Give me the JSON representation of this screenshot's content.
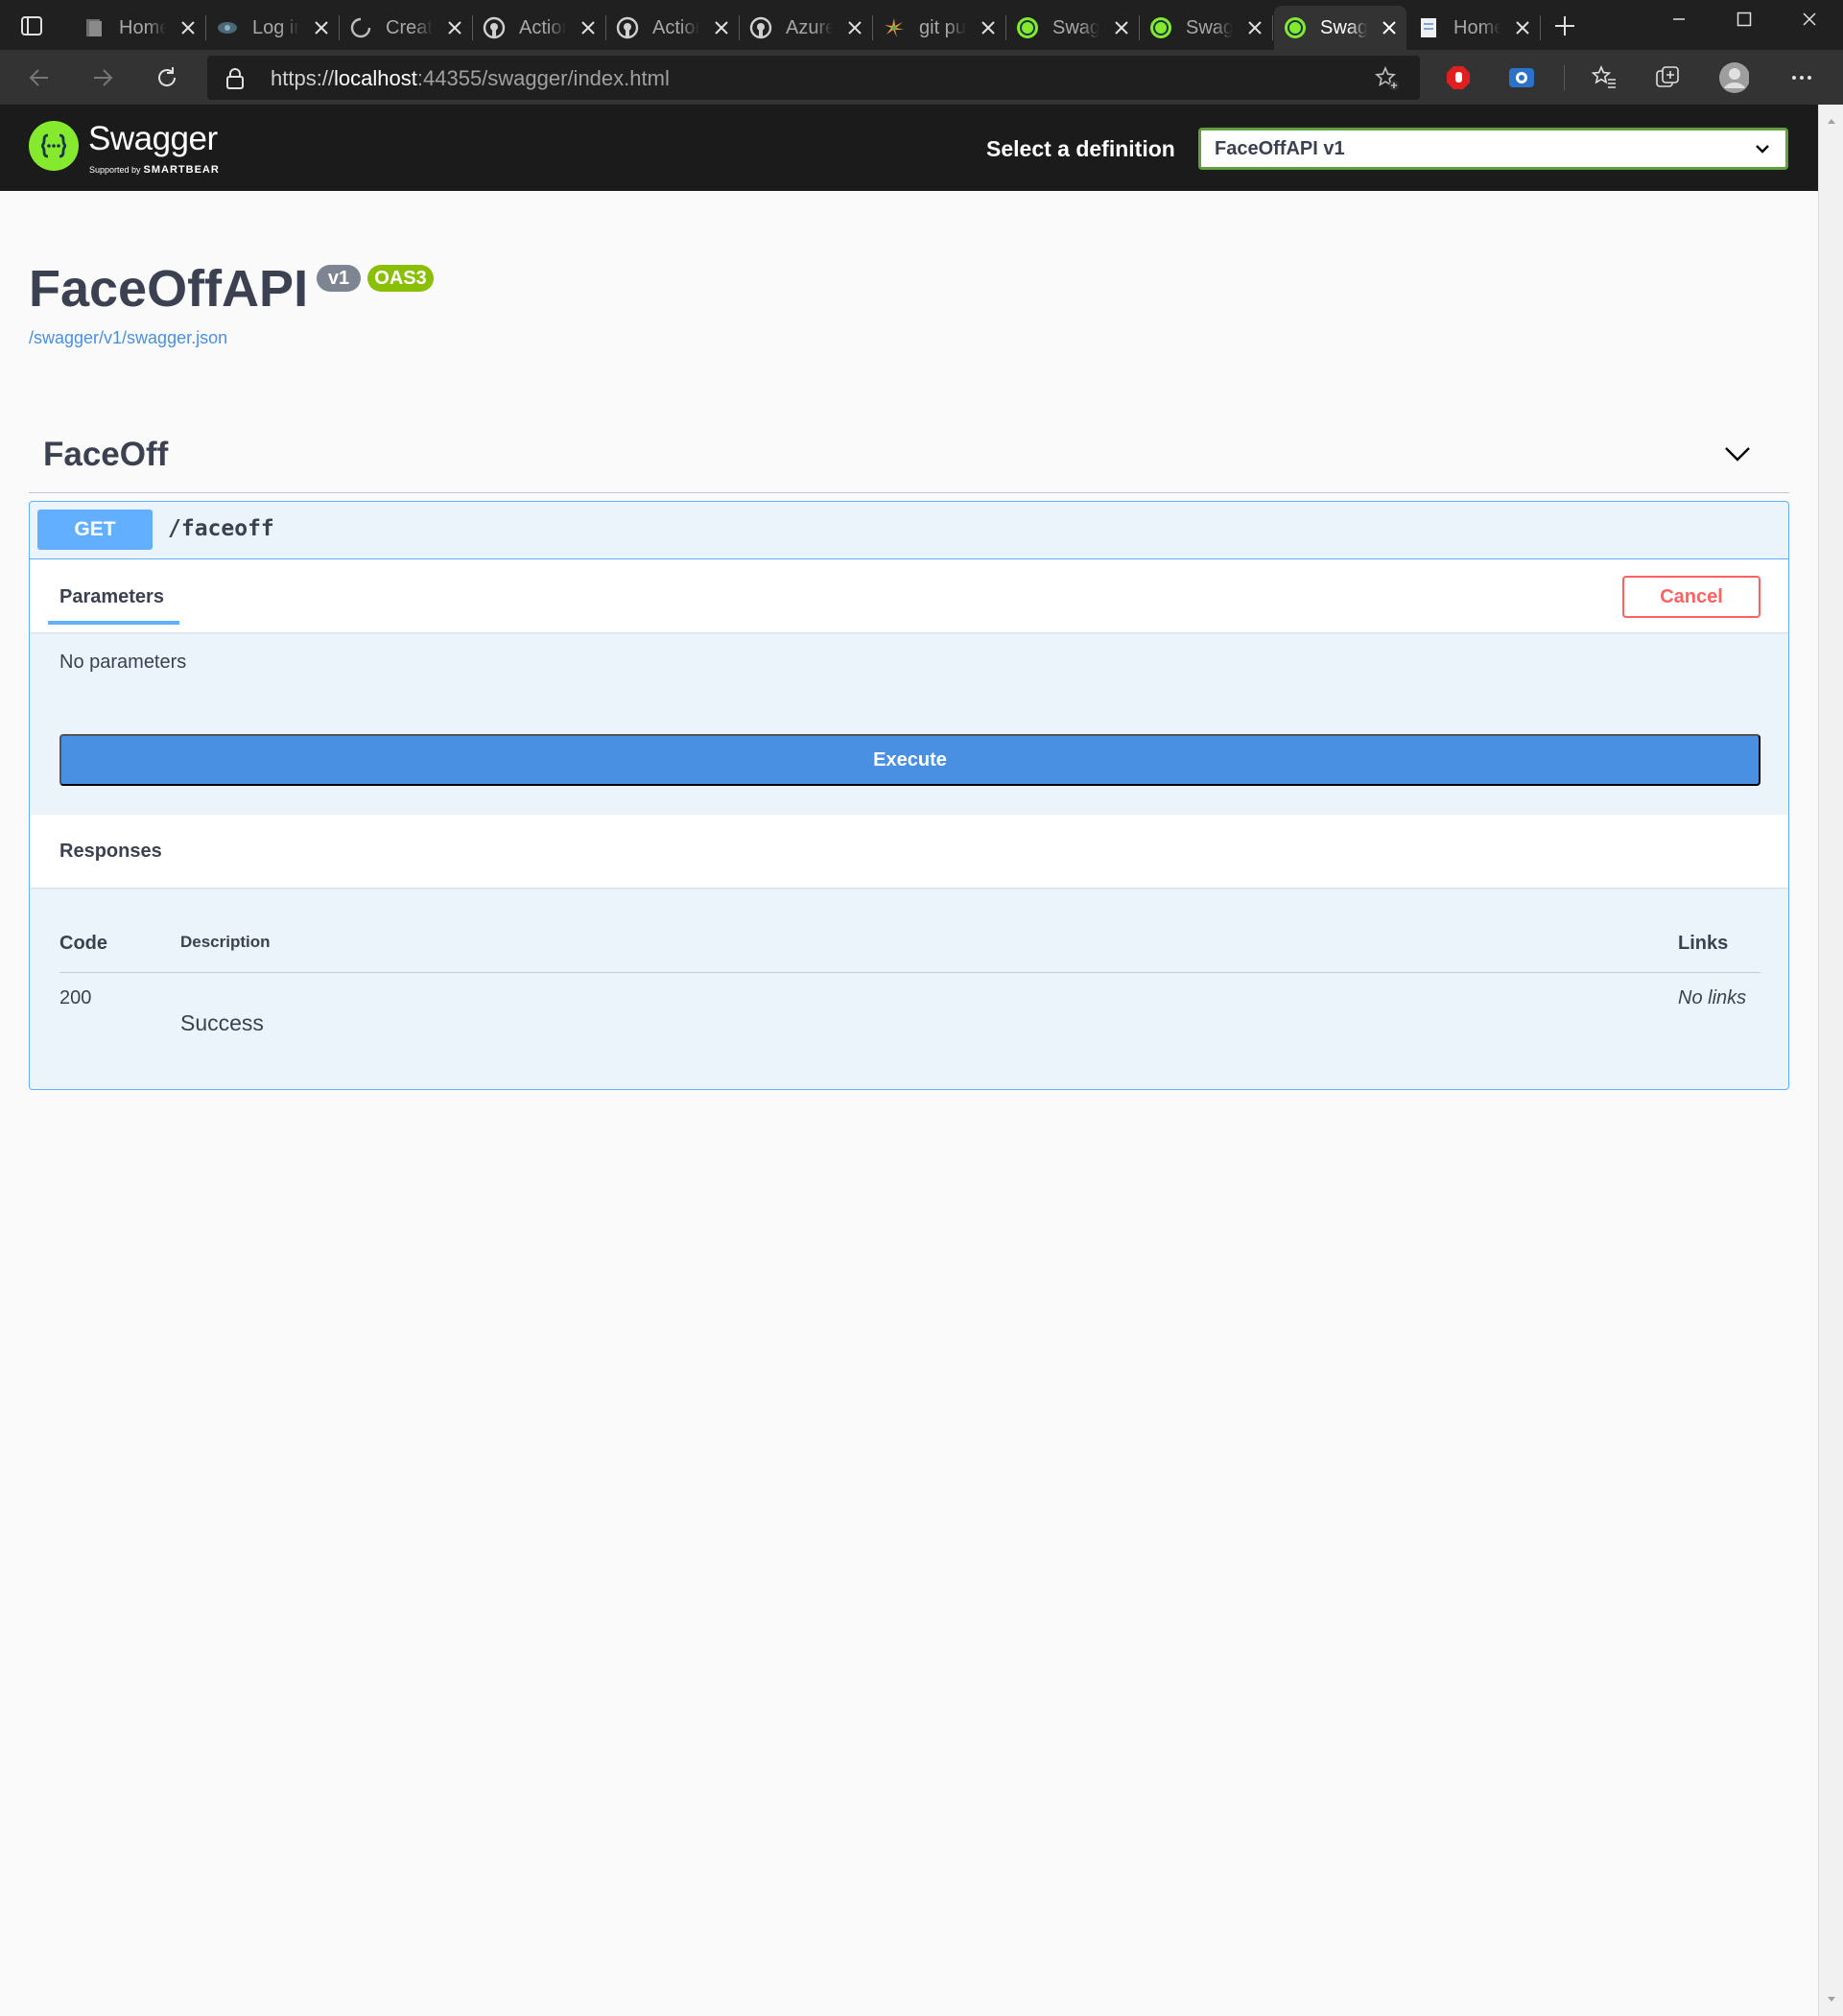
{
  "browser": {
    "tabs": [
      {
        "title": "Home",
        "icon": "page-stack-icon",
        "active": false
      },
      {
        "title": "Log in",
        "icon": "eye-icon",
        "active": false
      },
      {
        "title": "Create",
        "icon": "loading-icon",
        "active": false
      },
      {
        "title": "Actions",
        "icon": "github-icon",
        "active": false
      },
      {
        "title": "Actions",
        "icon": "github-icon",
        "active": false
      },
      {
        "title": "Azure",
        "icon": "github-icon",
        "active": false
      },
      {
        "title": "git pull",
        "icon": "burst-icon",
        "active": false
      },
      {
        "title": "Swagger",
        "icon": "swagger-icon",
        "active": false
      },
      {
        "title": "Swagger",
        "icon": "swagger-icon",
        "active": false
      },
      {
        "title": "Swagger",
        "icon": "swagger-icon",
        "active": true
      },
      {
        "title": "Home",
        "icon": "document-icon",
        "active": false
      }
    ],
    "address": {
      "scheme": "https://",
      "host": "localhost",
      "rest": ":44355/swagger/index.html"
    },
    "colors": {
      "chrome_dark": "#202020",
      "toolbar": "#333333",
      "tab_active": "#333333"
    }
  },
  "swagger": {
    "brand": "Swagger",
    "supported_by": "Supported by",
    "smartbear": "SMARTBEAR",
    "select_definition_label": "Select a definition",
    "selected_definition": "FaceOffAPI v1",
    "colors": {
      "logo_green": "#85ea2d",
      "topbar": "#1b1b1b"
    }
  },
  "info": {
    "title": "FaceOffAPI",
    "version_badge": "v1",
    "oas_badge": "OAS3",
    "spec_url": "/swagger/v1/swagger.json"
  },
  "tag": {
    "name": "FaceOff",
    "operation": {
      "method": "GET",
      "path": "/faceoff",
      "parameters_tab": "Parameters",
      "cancel_label": "Cancel",
      "no_parameters": "No parameters",
      "execute_label": "Execute",
      "responses_title": "Responses",
      "response_columns": {
        "code": "Code",
        "description": "Description",
        "links": "Links"
      },
      "responses": [
        {
          "code": "200",
          "description": "Success",
          "links": "No links"
        }
      ],
      "colors": {
        "get": "#61affe",
        "execute": "#4990e2",
        "cancel": "#ff6060",
        "block_bg": "#ebf3fb"
      }
    }
  }
}
